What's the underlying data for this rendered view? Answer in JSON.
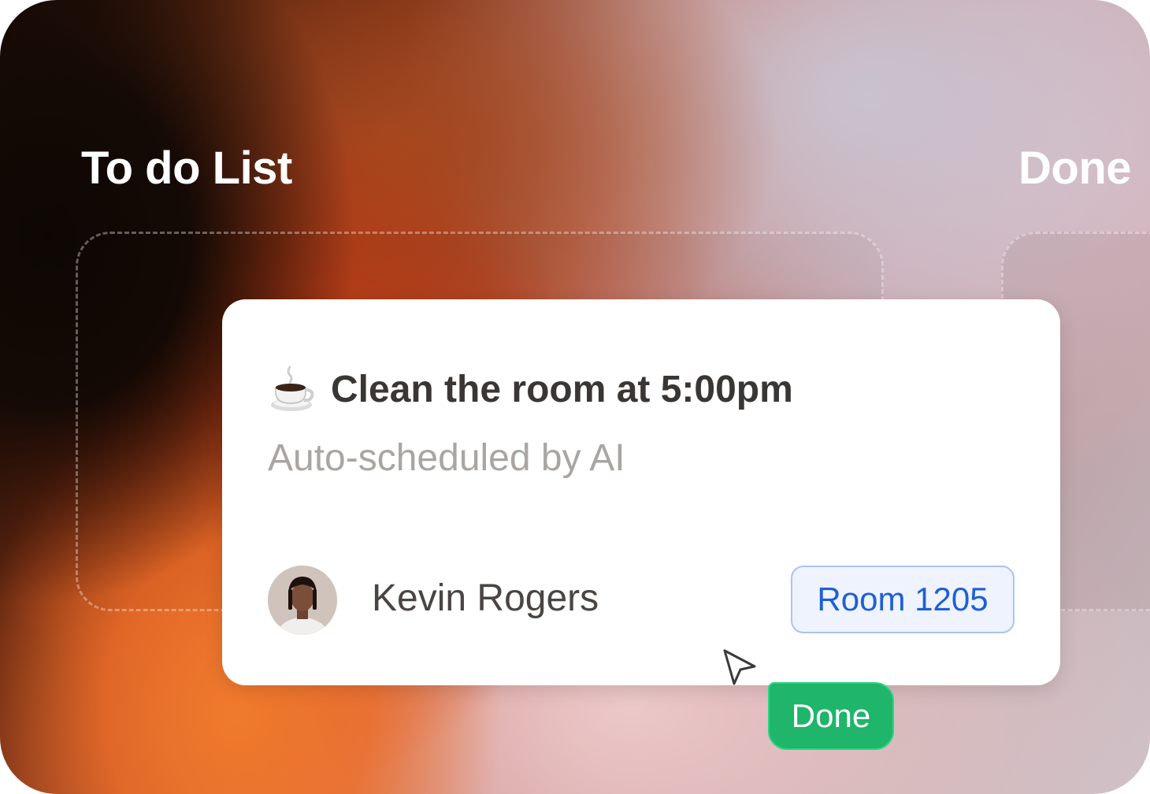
{
  "columns": {
    "todo_title": "To do List",
    "done_title": "Done"
  },
  "card": {
    "title": "Clean the room at 5:00pm",
    "subtitle": "Auto-scheduled by AI",
    "assignee": "Kevin Rogers",
    "room": "Room 1205",
    "icon": "coffee-cup-icon"
  },
  "drag_label": "Done",
  "colors": {
    "done_green": "#1fb56a",
    "room_blue": "#1f5fd6",
    "room_bg": "#eef3fe"
  }
}
